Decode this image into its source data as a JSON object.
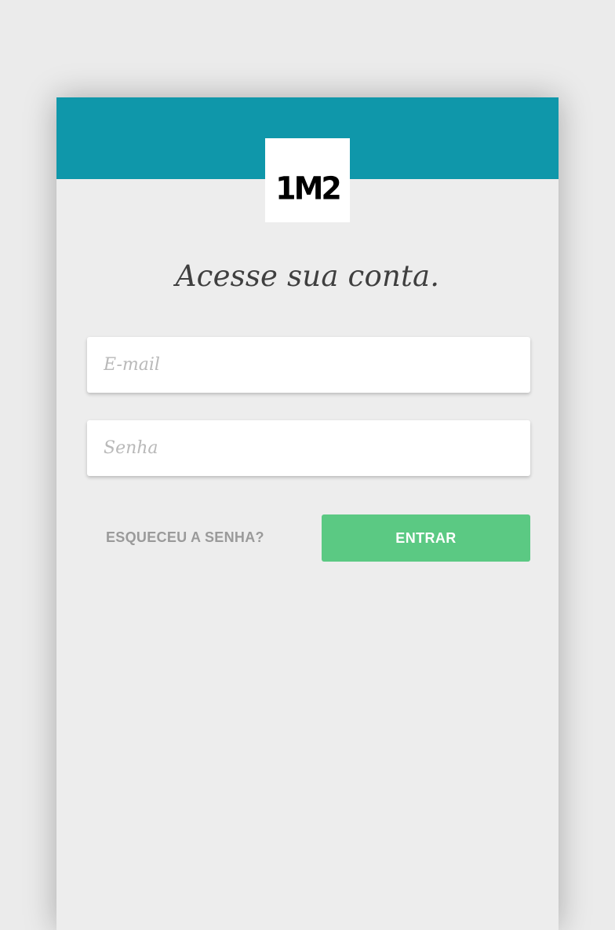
{
  "colors": {
    "header": "#0f97aa",
    "button": "#5bc983"
  },
  "logo": {
    "text": "1M2"
  },
  "title": "Acesse sua conta.",
  "form": {
    "email_placeholder": "E-mail",
    "email_value": "",
    "senha_placeholder": "Senha",
    "senha_value": ""
  },
  "actions": {
    "forgot_label": "ESQUECEU A SENHA?",
    "enter_label": "ENTRAR"
  }
}
